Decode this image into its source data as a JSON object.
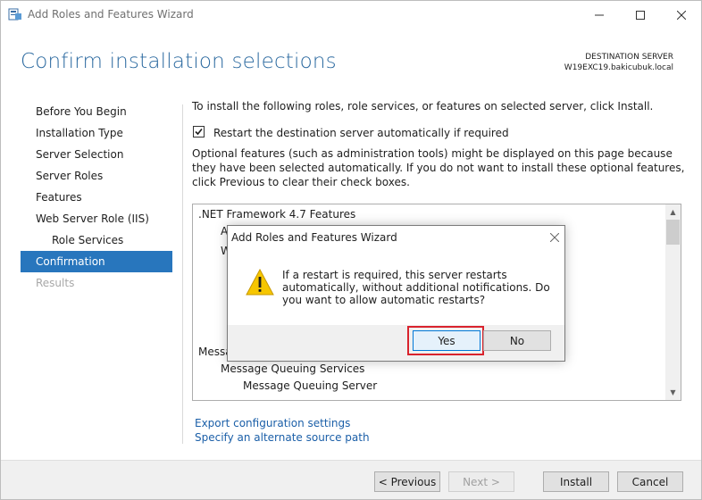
{
  "window": {
    "title": "Add Roles and Features Wizard",
    "controls": {
      "minimize_icon": "minimize-icon",
      "maximize_icon": "maximize-icon",
      "close_icon": "close-icon"
    }
  },
  "header": {
    "title": "Confirm installation selections",
    "destination_label": "DESTINATION SERVER",
    "destination_server": "W19EXC19.bakicubuk.local"
  },
  "nav": {
    "items": [
      {
        "label": "Before You Begin",
        "state": "normal"
      },
      {
        "label": "Installation Type",
        "state": "normal"
      },
      {
        "label": "Server Selection",
        "state": "normal"
      },
      {
        "label": "Server Roles",
        "state": "normal"
      },
      {
        "label": "Features",
        "state": "normal"
      },
      {
        "label": "Web Server Role (IIS)",
        "state": "normal"
      },
      {
        "label": "Role Services",
        "state": "sub"
      },
      {
        "label": "Confirmation",
        "state": "active"
      },
      {
        "label": "Results",
        "state": "disabled"
      }
    ]
  },
  "main": {
    "intro": "To install the following roles, role services, or features on selected server, click Install.",
    "restart_checkbox": {
      "checked": true,
      "label": "Restart the destination server automatically if required"
    },
    "optional_text": "Optional features (such as administration tools) might be displayed on this page because they have been selected automatically. If you do not want to install these optional features, click Previous to clear their check boxes.",
    "features_list": {
      "items": [
        ".NET Framework 4.7 Features",
        "A",
        "W",
        "Message",
        "Message Queuing Services",
        "Message Queuing Server"
      ]
    },
    "links": {
      "export": "Export configuration settings",
      "alternate_source": "Specify an alternate source path"
    }
  },
  "footer": {
    "previous": "< Previous",
    "next": "Next >",
    "install": "Install",
    "cancel": "Cancel"
  },
  "dialog": {
    "title": "Add Roles and Features Wizard",
    "icon": "warning-icon",
    "message": "If a restart is required, this server restarts automatically, without additional notifications. Do you want to allow automatic restarts?",
    "yes": "Yes",
    "no": "No",
    "highlight_color": "#d9232d"
  },
  "colors": {
    "accent": "#2876bd",
    "title": "#2c6aa0",
    "link": "#1b5fa8"
  }
}
